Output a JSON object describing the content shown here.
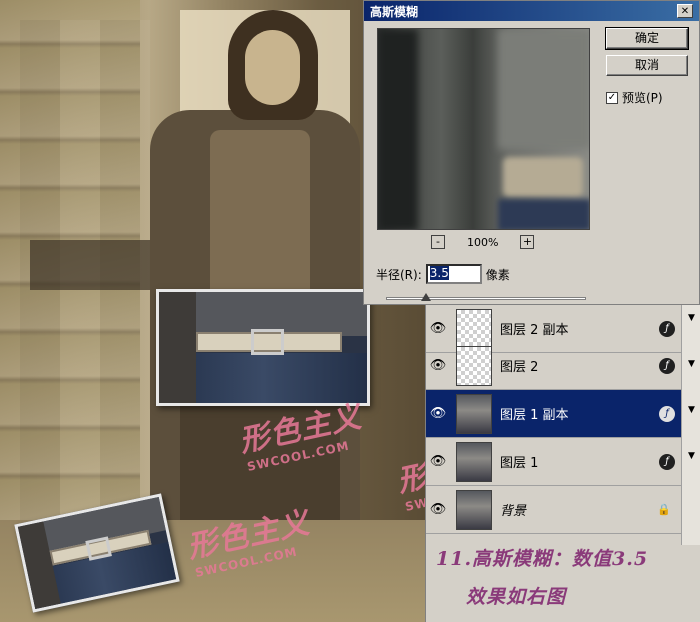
{
  "dialog": {
    "title": "高斯模糊",
    "close_icon": "close-icon",
    "ok_label": "确定",
    "cancel_label": "取消",
    "preview_label": "预览(P)",
    "preview_checked": true,
    "zoom_minus": "-",
    "zoom_value": "100%",
    "zoom_plus": "+",
    "radius_label": "半径(R):",
    "radius_value": "3.5",
    "radius_unit": "像素",
    "slider_value": 3.5
  },
  "layers": [
    {
      "name": "图层 2 副本",
      "thumb": "transparent",
      "fx": true,
      "selected": false
    },
    {
      "name": "图层 2",
      "thumb": "transparent",
      "fx": true,
      "selected": false
    },
    {
      "name": "图层 1 副本",
      "thumb": "photo",
      "fx": true,
      "selected": true
    },
    {
      "name": "图层 1",
      "thumb": "photo",
      "fx": true,
      "selected": false
    },
    {
      "name": "背景",
      "thumb": "photo",
      "fx": false,
      "locked": true,
      "selected": false
    }
  ],
  "watermark": {
    "cn": "形色主义",
    "en": "SWCOOL.COM"
  },
  "caption": {
    "line1": "11.高斯模糊：数值3.5",
    "line2": "效果如右图"
  },
  "icons": {
    "eye": "eye-icon",
    "fx": "fx-icon",
    "lock": "lock-icon"
  }
}
